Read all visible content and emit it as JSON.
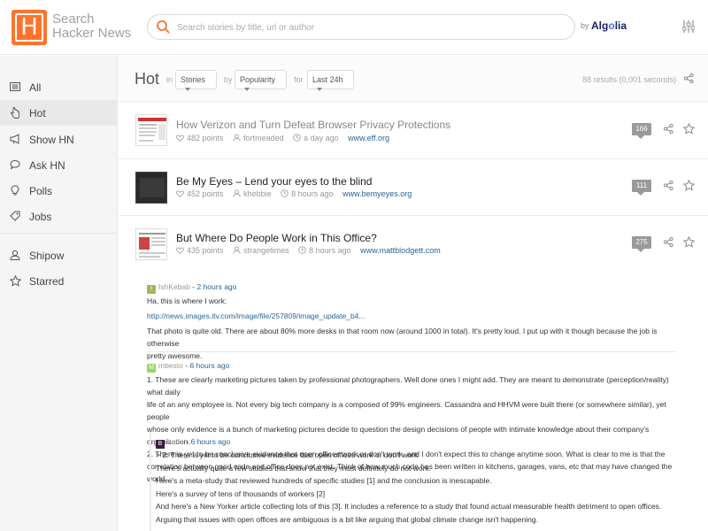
{
  "header": {
    "logo_letter": "H",
    "logo_line1": "Search",
    "logo_line2": "Hacker News",
    "search_placeholder": "Search stories by title, url or author",
    "by_label": "by",
    "algolia_a": "Alg",
    "algolia_o": "o",
    "algolia_b": "lia"
  },
  "sidebar": {
    "items": [
      {
        "label": "All",
        "icon": "newspaper-icon"
      },
      {
        "label": "Hot",
        "icon": "pointer-icon"
      },
      {
        "label": "Show HN",
        "icon": "megaphone-icon"
      },
      {
        "label": "Ask HN",
        "icon": "chat-icon"
      },
      {
        "label": "Polls",
        "icon": "lightbulb-icon"
      },
      {
        "label": "Jobs",
        "icon": "tag-icon"
      },
      {
        "label": "Shipow",
        "icon": "user-icon"
      },
      {
        "label": "Starred",
        "icon": "star-icon"
      }
    ]
  },
  "filters": {
    "title": "Hot",
    "in_label": "in",
    "type_value": "Stories",
    "by_label": "by",
    "sort_value": "Popularity",
    "for_label": "for",
    "range_value": "Last 24h",
    "results": "88 results (0,001 seconds)"
  },
  "stories": [
    {
      "title": "How Verizon and Turn Defeat Browser Privacy Protections",
      "points": "482 points",
      "author": "fortmeaded",
      "time": "a day ago",
      "domain": "www.eff.org",
      "comments": "166"
    },
    {
      "title": "Be My Eyes – Lend your eyes to the blind",
      "points": "452 points",
      "author": "khebbie",
      "time": "8 hours ago",
      "domain": "www.bemyeyes.org",
      "comments": "111"
    },
    {
      "title": "But Where Do People Work in This Office?",
      "points": "435 points",
      "author": "strangetimes",
      "time": "8 hours ago",
      "domain": "www.mattblodgett.com",
      "comments": "275"
    }
  ],
  "comments": [
    {
      "avatar": "I",
      "author": "IshKebab",
      "sep": " - ",
      "time": "2 hours ago",
      "lines": [
        "Ha, this is where I work:",
        "http://news.images.itv.com/image/file/257809/image_update_b4...",
        "That photo is quite old. There are about 80% more desks in that room now (around 1000 in total). It's pretty loud. I put up with it though because the job is otherwise",
        "pretty awesome."
      ]
    },
    {
      "avatar": "M",
      "author": "mbesto",
      "sep": " - ",
      "time": "6 hours ago",
      "lines": [
        "1. These are clearly marketing pictures taken by professional photographers. Well done ones I might add. They are meant to demonstrate (perception/reality) what daily",
        "life of an any employee is. Not every big tech company is a composed of 99% engineers. Cassandra and HHVM were built there (or somewhere similar), yet people",
        "whose only evidence is a bunch of marketing pictures decide to question the design decisions of people with intimate knowledge about their company's organization.",
        "2. There is yet to be conclusive evidence that open offices work or don't work, and I don't expect this to change anytime soon. What is clear to me is that the",
        "correlation between good code and office does not exist. Think of how much code has been written in kitchens, garages, vans, etc that may have changed the world..."
      ]
    },
    {
      "avatar": "B",
      "author": "bane",
      "sep": " - ",
      "time": "6 hours ago",
      "lines": [
        "> 2. There is yet to be conclusive evidence that open offices work or don't work",
        "There's actually quite a few studies that show that they most definitely do not work.",
        "Here's a meta-study that reviewed hundreds of specific studies [1] and the conclusion is inescapable.",
        "Here's a survey of tens of thousands of workers [2]",
        "And here's a New Yorker article collecting lots of this [3]. It includes a reference to a study that found actual measurable health detriment to open offices.",
        "Arguing that issues with open offices are ambiguous is a bit like arguing that global climate change isn't happening."
      ]
    }
  ],
  "colors": {
    "brand": "#ff742b",
    "link": "#2a6496",
    "avatar_i": "#a8b35a",
    "avatar_m": "#9bd36a",
    "avatar_b": "#3a1b3d"
  }
}
